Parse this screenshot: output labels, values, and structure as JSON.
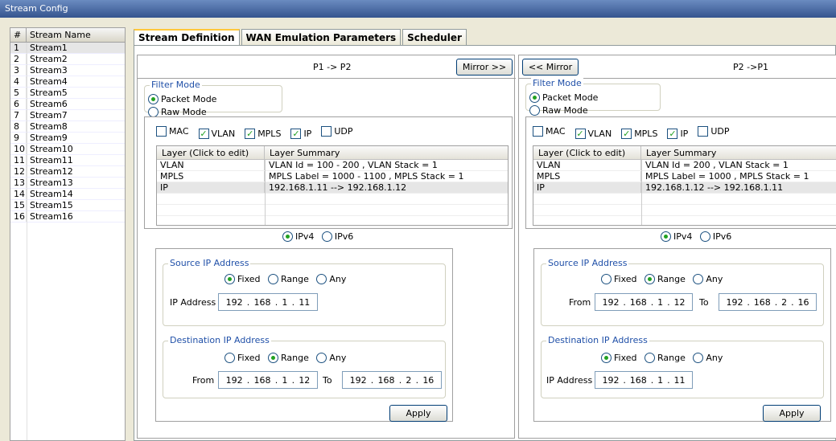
{
  "window": {
    "title": "Stream Config"
  },
  "stream_list": {
    "headers": [
      "#",
      "Stream Name"
    ],
    "rows": [
      {
        "n": "1",
        "name": "Stream1"
      },
      {
        "n": "2",
        "name": "Stream2"
      },
      {
        "n": "3",
        "name": "Stream3"
      },
      {
        "n": "4",
        "name": "Stream4"
      },
      {
        "n": "5",
        "name": "Stream5"
      },
      {
        "n": "6",
        "name": "Stream6"
      },
      {
        "n": "7",
        "name": "Stream7"
      },
      {
        "n": "8",
        "name": "Stream8"
      },
      {
        "n": "9",
        "name": "Stream9"
      },
      {
        "n": "10",
        "name": "Stream10"
      },
      {
        "n": "11",
        "name": "Stream11"
      },
      {
        "n": "12",
        "name": "Stream12"
      },
      {
        "n": "13",
        "name": "Stream13"
      },
      {
        "n": "14",
        "name": "Stream14"
      },
      {
        "n": "15",
        "name": "Stream15"
      },
      {
        "n": "16",
        "name": "Stream16"
      }
    ]
  },
  "tabs": [
    "Stream Definition",
    "WAN Emulation Parameters",
    "Scheduler"
  ],
  "left": {
    "direction": "P1 -> P2",
    "mirror_label": "Mirror >>",
    "filter_mode": {
      "title": "Filter Mode",
      "packet": "Packet Mode",
      "raw": "Raw Mode"
    },
    "checks": [
      {
        "label": "MAC",
        "checked": false
      },
      {
        "label": "VLAN",
        "checked": true
      },
      {
        "label": "MPLS",
        "checked": true
      },
      {
        "label": "IP",
        "checked": true
      },
      {
        "label": "UDP",
        "checked": false
      }
    ],
    "layer_headers": [
      "Layer (Click to edit)",
      "Layer Summary"
    ],
    "layers": [
      {
        "layer": "VLAN",
        "summary": "VLAN Id = 100 - 200  ,  VLAN Stack = 1"
      },
      {
        "layer": "MPLS",
        "summary": "MPLS Label = 1000 - 1100  ,  MPLS Stack = 1"
      },
      {
        "layer": "IP",
        "summary": "192.168.1.11 --> 192.168.1.12"
      }
    ],
    "ipv4": "IPv4",
    "ipv6": "IPv6",
    "source": {
      "title": "Source IP Address",
      "fixed": "Fixed",
      "range": "Range",
      "any": "Any",
      "ip_label": "IP Address",
      "ip": [
        "192",
        "168",
        "1",
        "11"
      ]
    },
    "dest": {
      "title": "Destination IP Address",
      "fixed": "Fixed",
      "range": "Range",
      "any": "Any",
      "from_label": "From",
      "to_label": "To",
      "from": [
        "192",
        "168",
        "1",
        "12"
      ],
      "to": [
        "192",
        "168",
        "2",
        "16"
      ]
    },
    "apply": "Apply"
  },
  "right": {
    "direction": "P2 ->P1",
    "mirror_label": "<< Mirror",
    "filter_mode": {
      "title": "Filter Mode",
      "packet": "Packet Mode",
      "raw": "Raw Mode"
    },
    "checks": [
      {
        "label": "MAC",
        "checked": false
      },
      {
        "label": "VLAN",
        "checked": true
      },
      {
        "label": "MPLS",
        "checked": true
      },
      {
        "label": "IP",
        "checked": true
      },
      {
        "label": "UDP",
        "checked": false
      }
    ],
    "layer_headers": [
      "Layer (Click to edit)",
      "Layer Summary"
    ],
    "layers": [
      {
        "layer": "VLAN",
        "summary": "VLAN Id = 200  ,  VLAN Stack = 1"
      },
      {
        "layer": "MPLS",
        "summary": "MPLS Label = 1000  ,  MPLS Stack = 1"
      },
      {
        "layer": "IP",
        "summary": "192.168.1.12 --> 192.168.1.11"
      }
    ],
    "ipv4": "IPv4",
    "ipv6": "IPv6",
    "source": {
      "title": "Source IP Address",
      "fixed": "Fixed",
      "range": "Range",
      "any": "Any",
      "from_label": "From",
      "to_label": "To",
      "from": [
        "192",
        "168",
        "1",
        "12"
      ],
      "to": [
        "192",
        "168",
        "2",
        "16"
      ]
    },
    "dest": {
      "title": "Destination IP Address",
      "fixed": "Fixed",
      "range": "Range",
      "any": "Any",
      "ip_label": "IP Address",
      "ip": [
        "192",
        "168",
        "1",
        "11"
      ]
    },
    "apply": "Apply"
  }
}
